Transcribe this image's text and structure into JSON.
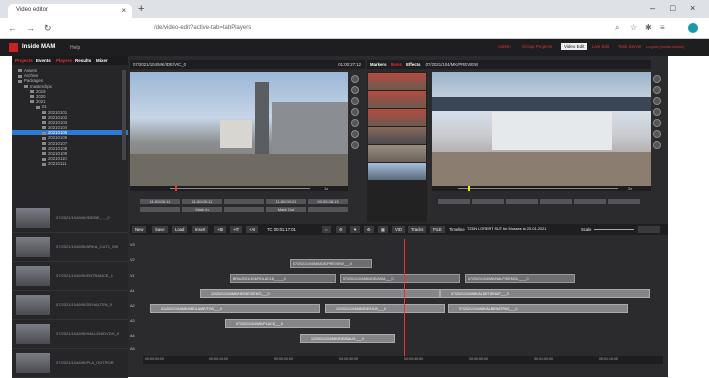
{
  "browser": {
    "tab_title": "Video editor",
    "url": "/de/video-edit?active-tab=tabPlayers"
  },
  "app": {
    "name": "Inside MAM",
    "help": "Help",
    "menu": [
      "Admin",
      "Group Projects",
      "Video Edit",
      "Live Edit",
      "Task Server",
      "Logout (inside.admin)"
    ],
    "active_menu": "Video Edit"
  },
  "sidebar": {
    "tabs": [
      "Projects",
      "Events",
      "Players",
      "Results",
      "Mixer"
    ],
    "tree": [
      "Assets",
      "Archive",
      "Packages",
      "masterclips",
      "2019",
      "2020",
      "2021",
      "01",
      "20210101",
      "20210102",
      "20210103",
      "20210104",
      "20210105",
      "20210106",
      "20210107",
      "20210108",
      "20210109",
      "20210110",
      "20210111"
    ],
    "selected_index": 12,
    "thumbs": [
      "07/2021/104/MK/IDE/BE_..._0",
      "07/2021/104/MK/ARKA_CUT1_MK",
      "07/2021/104/MK/ENTRANCE_1",
      "07/2021/104/MK/DEHALTEN_0",
      "07/2021/104/MK/HALLEN/DVDH_0",
      "07/2021/104/MK/PLA_OUTROR"
    ]
  },
  "player_left": {
    "title": "07/2021/104/MK/IDE/VIC_0",
    "timecode": "01:00:27:12",
    "progress_label": "1x",
    "buttons_row1": [
      "11:00:00:11",
      "11:00:00:11",
      "",
      "11:00:00:21",
      "00:00:38:13"
    ],
    "buttons_row2": [
      "",
      "Mark In",
      "",
      "Mark Out",
      ""
    ]
  },
  "markers": {
    "tabs": [
      "Markers",
      "Items",
      "Effects"
    ],
    "title": "07/2021/104/MK/PREVIEW"
  },
  "player_right": {
    "progress_label": "2x",
    "buttons": [
      "",
      "",
      "",
      "",
      "",
      ""
    ]
  },
  "toolbar": {
    "buttons": [
      "New",
      "Save",
      "Load",
      "Insert",
      "+BI",
      "+IT",
      "+AI"
    ],
    "timecode": "TC 00:01:17:01",
    "vid": "VID",
    "tracks": "Tracks",
    "file": "FILE",
    "timeline_label": "Timeline",
    "timeline_name": "TZDN LORERT SUT for Mosses to 20-01-2021",
    "scale": "Scale"
  },
  "timeline": {
    "track_labels": [
      "V3",
      "V2",
      "V1",
      "A1",
      "A2",
      "A3",
      "A4",
      "A5"
    ],
    "clips": [
      {
        "row": 0,
        "text": "07/2021/104/MK/IDE/PREVIEW___0"
      },
      {
        "row": 1,
        "text": "BRA/2021/104/ROLAC18_____0"
      },
      {
        "row": 1,
        "text": "07/2021/104/MK/IDE/AS/A___0"
      },
      {
        "row": 1,
        "text": "07/2021/104/MK/NALP/DEMOL____0"
      },
      {
        "row": 2,
        "text": "12/2021/104/MK/HEIME/DEMO___0"
      },
      {
        "row": 2,
        "text": "07/2021/104/MK/ALDETIENAP___0"
      },
      {
        "row": 3,
        "text": "01/2021/104/MK/IME/LAME/TOD___0"
      },
      {
        "row": 3,
        "text": "12/2021/104/MK/IDE/HUS___0"
      },
      {
        "row": 3,
        "text": "07/2021/104/MK/ALBENATPAS___0"
      },
      {
        "row": 4,
        "text": "07/2021/104/MK/PLAC8___0"
      },
      {
        "row": 5,
        "text": "12/2021/104/MK/IDE/BAU/1___0"
      }
    ],
    "ruler": [
      "00:00:00:00",
      "00:00:10:00",
      "00:00:20:00",
      "00:00:30:00",
      "00:00:40:00",
      "00:00:50:00",
      "00:01:00:00",
      "00:01:10:00",
      "00:01:20:00"
    ]
  }
}
